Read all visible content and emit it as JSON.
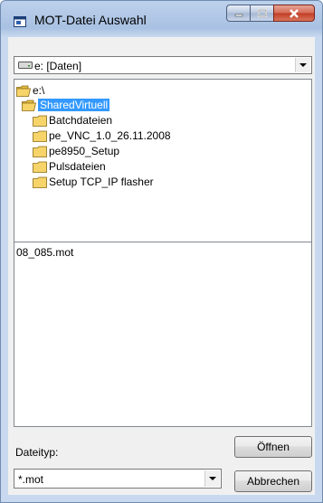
{
  "window": {
    "title": "MOT-Datei Auswahl"
  },
  "drive_combo": {
    "value": "e: [Daten]",
    "icon": "drive-icon"
  },
  "folders": [
    {
      "label": "e:\\",
      "icon": "open-folder-icon",
      "selected": false
    },
    {
      "label": "SharedVirtuell",
      "icon": "open-folder-icon",
      "selected": true
    },
    {
      "label": "Batchdateien",
      "icon": "folder-icon",
      "selected": false
    },
    {
      "label": "pe_VNC_1.0_26.11.2008",
      "icon": "folder-icon",
      "selected": false
    },
    {
      "label": "pe8950_Setup",
      "icon": "folder-icon",
      "selected": false
    },
    {
      "label": "Pulsdateien",
      "icon": "folder-icon",
      "selected": false
    },
    {
      "label": "Setup TCP_IP flasher",
      "icon": "folder-icon",
      "selected": false
    }
  ],
  "files": [
    "08_085.mot"
  ],
  "filetype": {
    "label": "Dateityp:",
    "value": "*.mot"
  },
  "buttons": {
    "open": "Öffnen",
    "cancel": "Abbrechen"
  },
  "colors": {
    "selection": "#3399ff",
    "folder": "#f6d46a",
    "close_button": "#c23b23"
  }
}
